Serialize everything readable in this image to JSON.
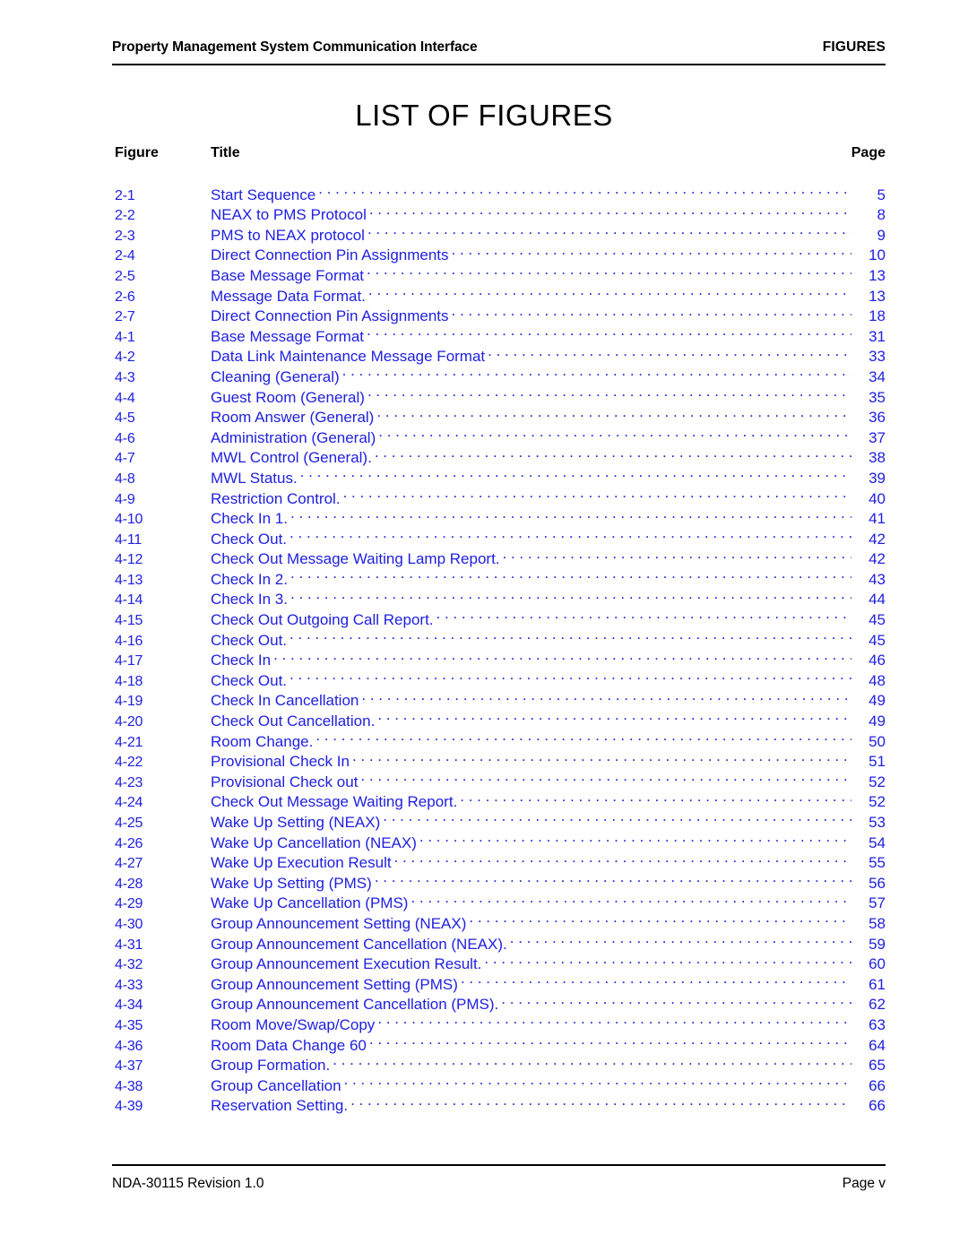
{
  "header": {
    "left_text": "Property Management System Communication Interface",
    "right_text": "FIGURES"
  },
  "title": "LIST OF FIGURES",
  "columns": {
    "figure": "Figure",
    "title": "Title",
    "page": "Page"
  },
  "colors": {
    "entry_blue": "#2020E0",
    "text_black": "#000000",
    "background": "#FFFFFF"
  },
  "figures": [
    {
      "number": "2-1",
      "title": "Start Sequence",
      "page": "5"
    },
    {
      "number": "2-2",
      "title": "NEAX to PMS Protocol",
      "page": "8"
    },
    {
      "number": "2-3",
      "title": "PMS to NEAX protocol",
      "page": "9"
    },
    {
      "number": "2-4",
      "title": "Direct Connection Pin Assignments",
      "page": "10"
    },
    {
      "number": "2-5",
      "title": "Base Message Format",
      "page": "13"
    },
    {
      "number": "2-6",
      "title": "Message Data Format.",
      "page": "13"
    },
    {
      "number": "2-7",
      "title": "Direct Connection Pin Assignments",
      "page": "18"
    },
    {
      "number": "4-1",
      "title": "Base Message Format",
      "page": "31"
    },
    {
      "number": "4-2",
      "title": "Data Link Maintenance Message Format",
      "page": "33"
    },
    {
      "number": "4-3",
      "title": "Cleaning (General)",
      "page": "34"
    },
    {
      "number": "4-4",
      "title": "Guest Room (General)",
      "page": "35"
    },
    {
      "number": "4-5",
      "title": "Room Answer (General)",
      "page": "36"
    },
    {
      "number": "4-6",
      "title": "Administration (General)",
      "page": "37"
    },
    {
      "number": "4-7",
      "title": "MWL Control (General).",
      "page": "38"
    },
    {
      "number": "4-8",
      "title": "MWL Status.",
      "page": "39"
    },
    {
      "number": "4-9",
      "title": "Restriction Control.",
      "page": "40"
    },
    {
      "number": "4-10",
      "title": "Check In 1.",
      "page": "41"
    },
    {
      "number": "4-11",
      "title": "Check Out.",
      "page": "42"
    },
    {
      "number": "4-12",
      "title": "Check Out Message Waiting Lamp Report.",
      "page": "42"
    },
    {
      "number": "4-13",
      "title": "Check In 2.",
      "page": "43"
    },
    {
      "number": "4-14",
      "title": "Check In 3.",
      "page": "44"
    },
    {
      "number": "4-15",
      "title": "Check Out Outgoing Call Report.",
      "page": "45"
    },
    {
      "number": "4-16",
      "title": "Check Out.",
      "page": "45"
    },
    {
      "number": "4-17",
      "title": "Check In",
      "page": "46"
    },
    {
      "number": "4-18",
      "title": "Check Out.",
      "page": "48"
    },
    {
      "number": "4-19",
      "title": "Check In Cancellation",
      "page": "49"
    },
    {
      "number": "4-20",
      "title": "Check Out Cancellation.",
      "page": "49"
    },
    {
      "number": "4-21",
      "title": "Room Change.",
      "page": "50"
    },
    {
      "number": "4-22",
      "title": "Provisional Check In",
      "page": "51"
    },
    {
      "number": "4-23",
      "title": "Provisional Check out",
      "page": "52"
    },
    {
      "number": "4-24",
      "title": "Check Out Message Waiting Report.",
      "page": "52"
    },
    {
      "number": "4-25",
      "title": "Wake Up Setting (NEAX)",
      "page": "53"
    },
    {
      "number": "4-26",
      "title": "Wake Up Cancellation (NEAX)",
      "page": "54"
    },
    {
      "number": "4-27",
      "title": "Wake Up Execution Result",
      "page": "55"
    },
    {
      "number": "4-28",
      "title": "Wake Up Setting (PMS)",
      "page": "56"
    },
    {
      "number": "4-29",
      "title": "Wake Up Cancellation (PMS)",
      "page": "57"
    },
    {
      "number": "4-30",
      "title": "Group Announcement Setting (NEAX)",
      "page": "58"
    },
    {
      "number": "4-31",
      "title": "Group Announcement Cancellation (NEAX).",
      "page": "59"
    },
    {
      "number": "4-32",
      "title": "Group Announcement Execution Result.",
      "page": "60"
    },
    {
      "number": "4-33",
      "title": "Group Announcement Setting (PMS)",
      "page": "61"
    },
    {
      "number": "4-34",
      "title": "Group Announcement Cancellation (PMS).",
      "page": "62"
    },
    {
      "number": "4-35",
      "title": "Room Move/Swap/Copy",
      "page": "63"
    },
    {
      "number": "4-36",
      "title": "Room Data Change 60",
      "page": "64"
    },
    {
      "number": "4-37",
      "title": "Group Formation.",
      "page": "65"
    },
    {
      "number": "4-38",
      "title": "Group Cancellation",
      "page": "66"
    },
    {
      "number": "4-39",
      "title": "Reservation Setting.",
      "page": "66"
    }
  ],
  "footer": {
    "left_text": "NDA-30115 Revision 1.0",
    "right_text": "Page v"
  }
}
